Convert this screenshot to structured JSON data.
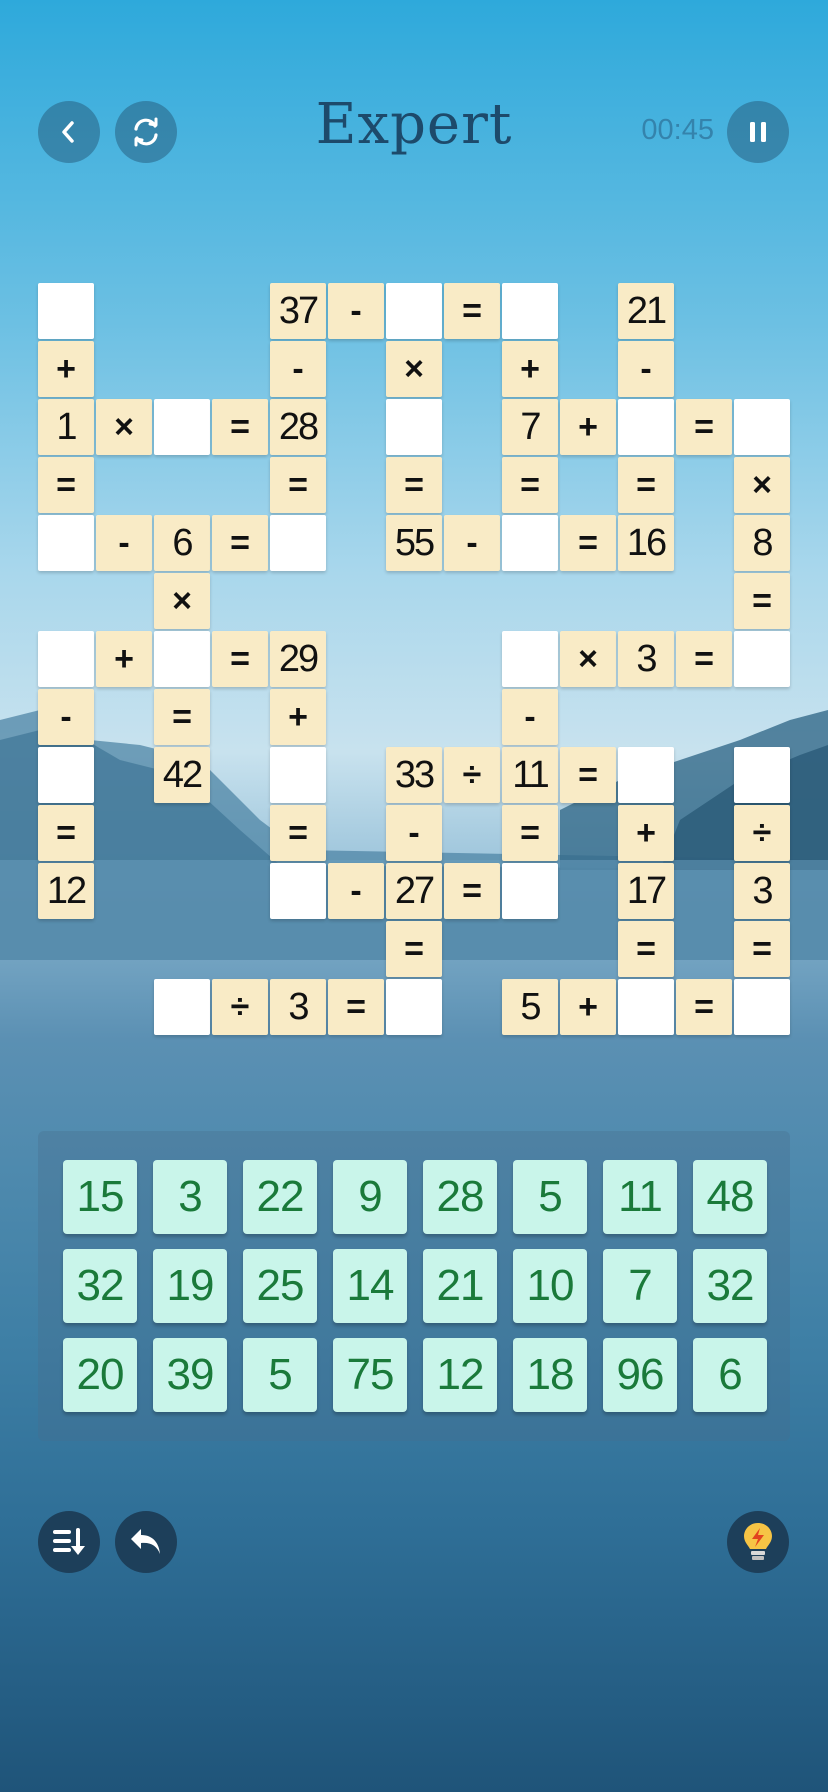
{
  "header": {
    "title": "Expert",
    "timer": "00:45",
    "back_icon": "chevron-left-icon",
    "restart_icon": "refresh-icon",
    "pause_icon": "pause-icon"
  },
  "colors": {
    "given_tile": "#f9ebc6",
    "blank_tile": "#ffffff",
    "number_tile": "#c9f5ea",
    "number_text": "#1a7a3a",
    "title": "#1d4a6b"
  },
  "grid": {
    "cells": [
      {
        "r": 0,
        "c": 0,
        "t": ""
      },
      {
        "r": 0,
        "c": 4,
        "t": "37"
      },
      {
        "r": 0,
        "c": 5,
        "t": "-"
      },
      {
        "r": 0,
        "c": 6,
        "t": ""
      },
      {
        "r": 0,
        "c": 7,
        "t": "="
      },
      {
        "r": 0,
        "c": 8,
        "t": ""
      },
      {
        "r": 0,
        "c": 10,
        "t": "21"
      },
      {
        "r": 1,
        "c": 0,
        "t": "+"
      },
      {
        "r": 1,
        "c": 4,
        "t": "-"
      },
      {
        "r": 1,
        "c": 6,
        "t": "×"
      },
      {
        "r": 1,
        "c": 8,
        "t": "+"
      },
      {
        "r": 1,
        "c": 10,
        "t": "-"
      },
      {
        "r": 2,
        "c": 0,
        "t": "1"
      },
      {
        "r": 2,
        "c": 1,
        "t": "×"
      },
      {
        "r": 2,
        "c": 2,
        "t": ""
      },
      {
        "r": 2,
        "c": 3,
        "t": "="
      },
      {
        "r": 2,
        "c": 4,
        "t": "28"
      },
      {
        "r": 2,
        "c": 6,
        "t": ""
      },
      {
        "r": 2,
        "c": 8,
        "t": "7"
      },
      {
        "r": 2,
        "c": 9,
        "t": "+"
      },
      {
        "r": 2,
        "c": 10,
        "t": ""
      },
      {
        "r": 2,
        "c": 11,
        "t": "="
      },
      {
        "r": 2,
        "c": 12,
        "t": ""
      },
      {
        "r": 3,
        "c": 0,
        "t": "="
      },
      {
        "r": 3,
        "c": 4,
        "t": "="
      },
      {
        "r": 3,
        "c": 6,
        "t": "="
      },
      {
        "r": 3,
        "c": 8,
        "t": "="
      },
      {
        "r": 3,
        "c": 10,
        "t": "="
      },
      {
        "r": 3,
        "c": 12,
        "t": "×"
      },
      {
        "r": 4,
        "c": 0,
        "t": ""
      },
      {
        "r": 4,
        "c": 1,
        "t": "-"
      },
      {
        "r": 4,
        "c": 2,
        "t": "6"
      },
      {
        "r": 4,
        "c": 3,
        "t": "="
      },
      {
        "r": 4,
        "c": 4,
        "t": ""
      },
      {
        "r": 4,
        "c": 6,
        "t": "55"
      },
      {
        "r": 4,
        "c": 7,
        "t": "-"
      },
      {
        "r": 4,
        "c": 8,
        "t": ""
      },
      {
        "r": 4,
        "c": 9,
        "t": "="
      },
      {
        "r": 4,
        "c": 10,
        "t": "16"
      },
      {
        "r": 4,
        "c": 12,
        "t": "8"
      },
      {
        "r": 5,
        "c": 2,
        "t": "×"
      },
      {
        "r": 5,
        "c": 12,
        "t": "="
      },
      {
        "r": 6,
        "c": 0,
        "t": ""
      },
      {
        "r": 6,
        "c": 1,
        "t": "+"
      },
      {
        "r": 6,
        "c": 2,
        "t": ""
      },
      {
        "r": 6,
        "c": 3,
        "t": "="
      },
      {
        "r": 6,
        "c": 4,
        "t": "29"
      },
      {
        "r": 6,
        "c": 8,
        "t": ""
      },
      {
        "r": 6,
        "c": 9,
        "t": "×"
      },
      {
        "r": 6,
        "c": 10,
        "t": "3"
      },
      {
        "r": 6,
        "c": 11,
        "t": "="
      },
      {
        "r": 6,
        "c": 12,
        "t": ""
      },
      {
        "r": 7,
        "c": 0,
        "t": "-"
      },
      {
        "r": 7,
        "c": 2,
        "t": "="
      },
      {
        "r": 7,
        "c": 4,
        "t": "+"
      },
      {
        "r": 7,
        "c": 8,
        "t": "-"
      },
      {
        "r": 8,
        "c": 0,
        "t": ""
      },
      {
        "r": 8,
        "c": 2,
        "t": "42"
      },
      {
        "r": 8,
        "c": 4,
        "t": ""
      },
      {
        "r": 8,
        "c": 6,
        "t": "33"
      },
      {
        "r": 8,
        "c": 7,
        "t": "÷"
      },
      {
        "r": 8,
        "c": 8,
        "t": "11"
      },
      {
        "r": 8,
        "c": 9,
        "t": "="
      },
      {
        "r": 8,
        "c": 10,
        "t": ""
      },
      {
        "r": 8,
        "c": 12,
        "t": ""
      },
      {
        "r": 9,
        "c": 0,
        "t": "="
      },
      {
        "r": 9,
        "c": 4,
        "t": "="
      },
      {
        "r": 9,
        "c": 6,
        "t": "-"
      },
      {
        "r": 9,
        "c": 8,
        "t": "="
      },
      {
        "r": 9,
        "c": 10,
        "t": "+"
      },
      {
        "r": 9,
        "c": 12,
        "t": "÷"
      },
      {
        "r": 10,
        "c": 0,
        "t": "12"
      },
      {
        "r": 10,
        "c": 4,
        "t": ""
      },
      {
        "r": 10,
        "c": 5,
        "t": "-"
      },
      {
        "r": 10,
        "c": 6,
        "t": "27"
      },
      {
        "r": 10,
        "c": 7,
        "t": "="
      },
      {
        "r": 10,
        "c": 8,
        "t": ""
      },
      {
        "r": 10,
        "c": 10,
        "t": "17"
      },
      {
        "r": 10,
        "c": 12,
        "t": "3"
      },
      {
        "r": 11,
        "c": 6,
        "t": "="
      },
      {
        "r": 11,
        "c": 10,
        "t": "="
      },
      {
        "r": 11,
        "c": 12,
        "t": "="
      },
      {
        "r": 12,
        "c": 2,
        "t": ""
      },
      {
        "r": 12,
        "c": 3,
        "t": "÷"
      },
      {
        "r": 12,
        "c": 4,
        "t": "3"
      },
      {
        "r": 12,
        "c": 5,
        "t": "="
      },
      {
        "r": 12,
        "c": 6,
        "t": ""
      },
      {
        "r": 12,
        "c": 8,
        "t": "5"
      },
      {
        "r": 12,
        "c": 9,
        "t": "+"
      },
      {
        "r": 12,
        "c": 10,
        "t": ""
      },
      {
        "r": 12,
        "c": 11,
        "t": "="
      },
      {
        "r": 12,
        "c": 12,
        "t": ""
      }
    ]
  },
  "number_bank": {
    "rows": [
      [
        "15",
        "3",
        "22",
        "9",
        "28",
        "5",
        "11",
        "48"
      ],
      [
        "32",
        "19",
        "25",
        "14",
        "21",
        "10",
        "7",
        "32"
      ],
      [
        "20",
        "39",
        "5",
        "75",
        "12",
        "18",
        "96",
        "6"
      ]
    ]
  },
  "footer": {
    "sort_icon": "sort-icon",
    "undo_icon": "undo-icon",
    "hint_icon": "lightbulb-icon"
  }
}
